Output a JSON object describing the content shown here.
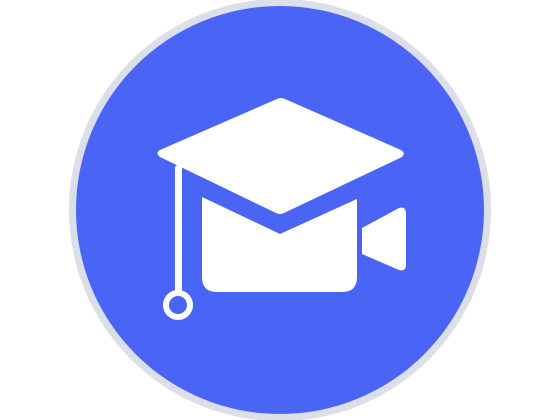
{
  "icon": {
    "name": "graduation-cap-video-camera-icon",
    "colors": {
      "background": "#ffffff",
      "ring": "#dcdfea",
      "fill": "#4a65f6",
      "glyph": "#ffffff"
    }
  }
}
